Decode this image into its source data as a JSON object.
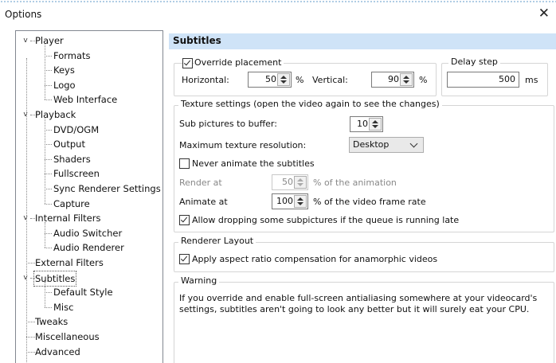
{
  "window": {
    "title": "Options",
    "close_glyph": "✕"
  },
  "tree": {
    "chevron_glyph": "v",
    "items": [
      {
        "label": "Player",
        "level": 0,
        "expanded": true
      },
      {
        "label": "Formats",
        "level": 1
      },
      {
        "label": "Keys",
        "level": 1
      },
      {
        "label": "Logo",
        "level": 1
      },
      {
        "label": "Web Interface",
        "level": 1
      },
      {
        "label": "Playback",
        "level": 0,
        "expanded": true
      },
      {
        "label": "DVD/OGM",
        "level": 1
      },
      {
        "label": "Output",
        "level": 1
      },
      {
        "label": "Shaders",
        "level": 1
      },
      {
        "label": "Fullscreen",
        "level": 1
      },
      {
        "label": "Sync Renderer Settings",
        "level": 1
      },
      {
        "label": "Capture",
        "level": 1
      },
      {
        "label": "Internal Filters",
        "level": 0,
        "expanded": true
      },
      {
        "label": "Audio Switcher",
        "level": 1
      },
      {
        "label": "Audio Renderer",
        "level": 1
      },
      {
        "label": "External Filters",
        "level": 0
      },
      {
        "label": "Subtitles",
        "level": 0,
        "expanded": true,
        "selected": true
      },
      {
        "label": "Default Style",
        "level": 1
      },
      {
        "label": "Misc",
        "level": 1
      },
      {
        "label": "Tweaks",
        "level": 0
      },
      {
        "label": "Miscellaneous",
        "level": 0
      },
      {
        "label": "Advanced",
        "level": 0
      }
    ]
  },
  "panel": {
    "header": "Subtitles",
    "placement": {
      "override_label": "Override placement",
      "override_checked": true,
      "horizontal_label": "Horizontal:",
      "horizontal_value": "50",
      "horizontal_unit": "%",
      "vertical_label": "Vertical:",
      "vertical_value": "90",
      "vertical_unit": "%"
    },
    "delay": {
      "title": "Delay step",
      "value": "500",
      "unit": "ms"
    },
    "texture": {
      "title": "Texture settings (open the video again to see the changes)",
      "sub_pictures_label": "Sub pictures to buffer:",
      "sub_pictures_value": "10",
      "max_res_label": "Maximum texture resolution:",
      "max_res_value": "Desktop",
      "never_animate_label": "Never animate the subtitles",
      "never_animate_checked": false,
      "render_at_label": "Render at",
      "render_at_value": "50",
      "render_at_suffix": "% of the animation",
      "animate_at_label": "Animate at",
      "animate_at_value": "100",
      "animate_at_suffix": "% of the video frame rate",
      "allow_dropping_label": "Allow dropping some subpictures if the queue is running late",
      "allow_dropping_checked": true
    },
    "renderer_layout": {
      "title": "Renderer Layout",
      "aspect_label": "Apply aspect ratio compensation for anamorphic videos",
      "aspect_checked": true
    },
    "warning": {
      "title": "Warning",
      "line1": "If you override and enable full-screen antialiasing somewhere at your videocard's",
      "line2": "settings, subtitles aren't going to look any better but it will surely eat your CPU."
    }
  }
}
